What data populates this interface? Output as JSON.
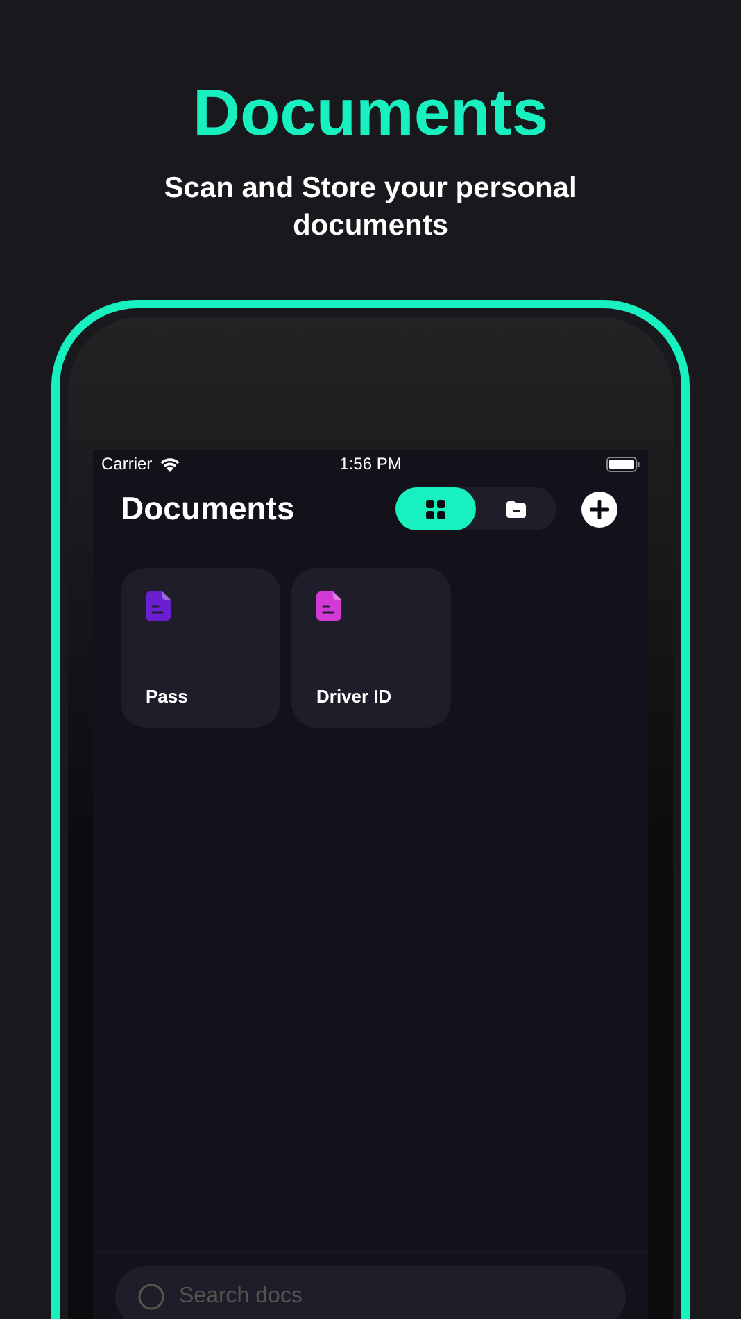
{
  "headline": "Documents",
  "subtitle": "Scan and Store your personal documents",
  "status_bar": {
    "carrier": "Carrier",
    "time": "1:56 PM"
  },
  "app_title": "Documents",
  "view_toggle": [
    {
      "kind": "grid",
      "selected": true
    },
    {
      "kind": "folder",
      "selected": false
    }
  ],
  "documents": [
    {
      "name": "Pass",
      "color": "#6a1fd0"
    },
    {
      "name": "Driver ID",
      "color": "#d23ad6"
    }
  ],
  "search": {
    "placeholder": "Search docs"
  }
}
